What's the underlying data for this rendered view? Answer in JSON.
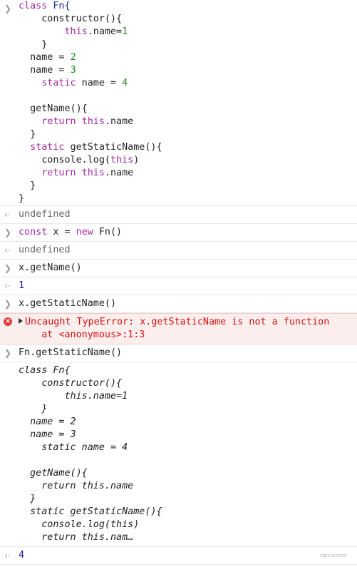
{
  "console": {
    "entries": [
      {
        "type": "input",
        "lines": [
          [
            [
              "class ",
              "kw"
            ],
            [
              "Fn{",
              "cls"
            ]
          ],
          [
            [
              "    constructor(){",
              "plain"
            ]
          ],
          [
            [
              "        ",
              "plain"
            ],
            [
              "this",
              "kw"
            ],
            [
              ".name=",
              "plain"
            ],
            [
              "1",
              "num"
            ]
          ],
          [
            [
              "    }",
              "plain"
            ]
          ],
          [
            [
              "  name = ",
              "plain"
            ],
            [
              "2",
              "num"
            ]
          ],
          [
            [
              "  name = ",
              "plain"
            ],
            [
              "3",
              "num"
            ]
          ],
          [
            [
              "    ",
              "plain"
            ],
            [
              "static",
              "kw"
            ],
            [
              " name = ",
              "plain"
            ],
            [
              "4",
              "num"
            ]
          ],
          [
            [
              "",
              "plain"
            ]
          ],
          [
            [
              "  getName(){",
              "plain"
            ]
          ],
          [
            [
              "    ",
              "plain"
            ],
            [
              "return",
              "kw"
            ],
            [
              " ",
              "plain"
            ],
            [
              "this",
              "kw"
            ],
            [
              ".name",
              "plain"
            ]
          ],
          [
            [
              "  }",
              "plain"
            ]
          ],
          [
            [
              "  ",
              "plain"
            ],
            [
              "static",
              "kw"
            ],
            [
              " getStaticName(){",
              "plain"
            ]
          ],
          [
            [
              "    console.log(",
              "plain"
            ],
            [
              "this",
              "kw"
            ],
            [
              ")",
              "plain"
            ]
          ],
          [
            [
              "    ",
              "plain"
            ],
            [
              "return",
              "kw"
            ],
            [
              " ",
              "plain"
            ],
            [
              "this",
              "kw"
            ],
            [
              ".name",
              "plain"
            ]
          ],
          [
            [
              "  }",
              "plain"
            ]
          ],
          [
            [
              "}",
              "plain"
            ]
          ]
        ]
      },
      {
        "type": "result",
        "lines": [
          [
            [
              "undefined",
              "undef"
            ]
          ]
        ]
      },
      {
        "type": "input",
        "lines": [
          [
            [
              "const",
              "kw"
            ],
            [
              " x = ",
              "plain"
            ],
            [
              "new",
              "kw"
            ],
            [
              " Fn()",
              "plain"
            ]
          ]
        ]
      },
      {
        "type": "result",
        "lines": [
          [
            [
              "undefined",
              "undef"
            ]
          ]
        ]
      },
      {
        "type": "input",
        "lines": [
          [
            [
              "x.getName()",
              "plain"
            ]
          ]
        ]
      },
      {
        "type": "result",
        "lines": [
          [
            [
              "1",
              "val"
            ]
          ]
        ]
      },
      {
        "type": "input",
        "lines": [
          [
            [
              "x.getStaticName()",
              "plain"
            ]
          ]
        ]
      },
      {
        "type": "error",
        "message": "Uncaught TypeError: x.getStaticName is not a function",
        "stack": "    at <anonymous>:1:3"
      },
      {
        "type": "input",
        "lines": [
          [
            [
              "Fn.getStaticName()",
              "plain"
            ]
          ]
        ]
      },
      {
        "type": "log",
        "lines": [
          [
            [
              "class Fn{",
              "plain"
            ]
          ],
          [
            [
              "    constructor(){",
              "plain"
            ]
          ],
          [
            [
              "        this.name=1",
              "plain"
            ]
          ],
          [
            [
              "    }",
              "plain"
            ]
          ],
          [
            [
              "  name = 2",
              "plain"
            ]
          ],
          [
            [
              "  name = 3",
              "plain"
            ]
          ],
          [
            [
              "    static name = 4",
              "plain"
            ]
          ],
          [
            [
              "",
              "plain"
            ]
          ],
          [
            [
              "  getName(){",
              "plain"
            ]
          ],
          [
            [
              "    return this.name",
              "plain"
            ]
          ],
          [
            [
              "  }",
              "plain"
            ]
          ],
          [
            [
              "  static getStaticName(){",
              "plain"
            ]
          ],
          [
            [
              "    console.log(this)",
              "plain"
            ]
          ],
          [
            [
              "    return this.nam…",
              "plain"
            ]
          ]
        ]
      },
      {
        "type": "result",
        "lines": [
          [
            [
              "4",
              "val"
            ]
          ]
        ]
      }
    ]
  },
  "icons": {
    "input": "chevron-right-icon",
    "result": "return-arrow-icon",
    "error": "error-circle-icon"
  },
  "colors": {
    "keyword": "#a42aa4",
    "number": "#1c8a1c",
    "error_text": "#d21414",
    "error_bg": "#fdeeee",
    "result_value": "#1a1aa6"
  }
}
